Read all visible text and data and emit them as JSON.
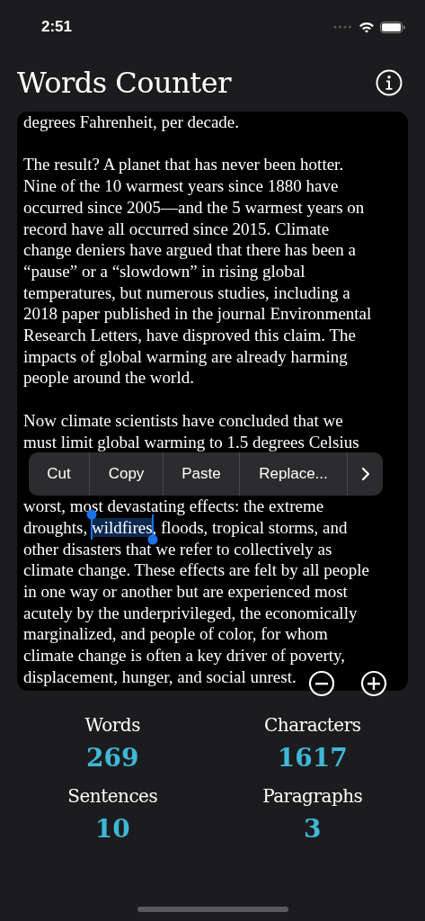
{
  "status_bar": {
    "time": "2:51"
  },
  "header": {
    "title": "Words Counter"
  },
  "editor": {
    "blocks": [
      {
        "kind": "paragraph",
        "lines": [
          {
            "text": "degrees Fahrenheit, per decade."
          }
        ]
      },
      {
        "kind": "paragraph",
        "lines": [
          {
            "text": "The result? A planet that has never been hotter."
          },
          {
            "text": "Nine of the 10 warmest years since 1880 have"
          },
          {
            "text": "occurred since 2005—and the 5 warmest years on"
          },
          {
            "text": "record have all occurred since 2015. Climate"
          },
          {
            "text": "change deniers have argued that there has been a"
          },
          {
            "text": "“pause” or a “slowdown” in rising global"
          },
          {
            "text": "temperatures, but numerous studies, including a"
          },
          {
            "text": "2018 paper published in the journal Environmental"
          },
          {
            "text": "Research Letters, have disproved this claim. The"
          },
          {
            "text": "impacts of global warming are already harming"
          },
          {
            "text": "people around the world."
          }
        ]
      },
      {
        "kind": "paragraph",
        "lines": [
          {
            "text": "Now climate scientists have concluded that we"
          },
          {
            "text": "must limit global warming to 1.5 degrees Celsius"
          }
        ]
      },
      {
        "kind": "edit_menu",
        "items": [
          "Cut",
          "Copy",
          "Paste",
          "Replace..."
        ]
      },
      {
        "kind": "continuation",
        "lines": [
          {
            "text": "worst, most devastating effects: the extreme"
          },
          {
            "text": "droughts, ",
            "selection": "wildfires",
            "rest": ", floods, tropical storms, and"
          },
          {
            "text": "other disasters that we refer to collectively as"
          },
          {
            "text": "climate change. These effects are felt by all people"
          },
          {
            "text": "in one way or another but are experienced most"
          },
          {
            "text": "acutely by the underprivileged, the economically"
          },
          {
            "text": "marginalized, and people of color, for whom"
          },
          {
            "text": "climate change is often a key driver of poverty,"
          },
          {
            "text": "displacement, hunger, and social unrest."
          }
        ]
      }
    ]
  },
  "stats": [
    {
      "label": "Words",
      "value": "269"
    },
    {
      "label": "Characters",
      "value": "1617"
    },
    {
      "label": "Sentences",
      "value": "10"
    },
    {
      "label": "Paragraphs",
      "value": "3"
    }
  ]
}
